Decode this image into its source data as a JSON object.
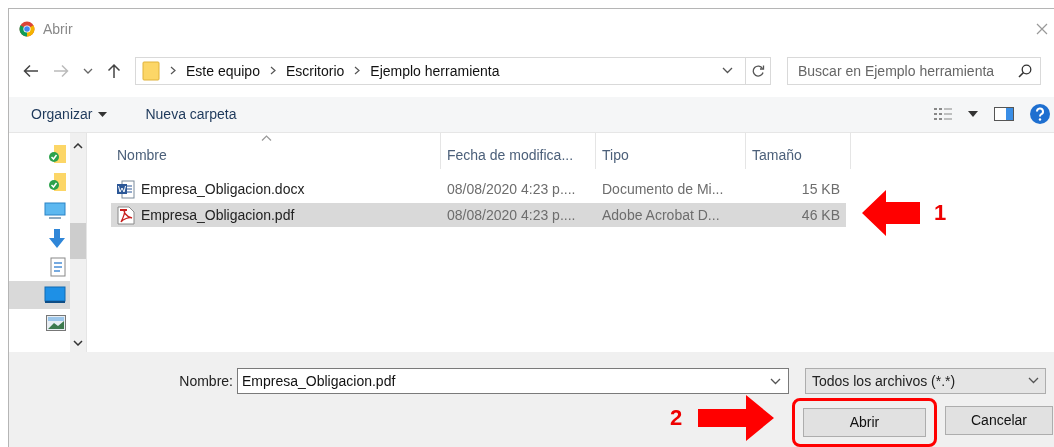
{
  "window": {
    "title": "Abrir"
  },
  "address_bar": {
    "path": [
      "Este equipo",
      "Escritorio",
      "Ejemplo herramienta"
    ]
  },
  "search": {
    "placeholder": "Buscar en Ejemplo herramienta"
  },
  "toolbar": {
    "buttons": [
      {
        "label": "Organizar",
        "kind": "menu"
      },
      {
        "label": "Nueva carpeta",
        "kind": "plain"
      }
    ]
  },
  "nav_pane": {
    "items": [
      {
        "kind": "synced-folder",
        "selected": false
      },
      {
        "kind": "synced-folder",
        "selected": false
      },
      {
        "kind": "computer",
        "selected": false
      },
      {
        "kind": "downloads",
        "selected": false
      },
      {
        "kind": "document",
        "selected": false
      },
      {
        "kind": "desktop",
        "selected": true
      },
      {
        "kind": "pictures",
        "selected": false
      }
    ]
  },
  "file_list": {
    "columns": [
      "Nombre",
      "Fecha de modifica...",
      "Tipo",
      "Tamaño"
    ],
    "rows": [
      {
        "kind": "word",
        "name": "Empresa_Obligacion.docx",
        "date": "08/08/2020 4:23 p....",
        "type": "Documento de Mi...",
        "size": "15 KB",
        "selected": false
      },
      {
        "kind": "pdf",
        "name": "Empresa_Obligacion.pdf",
        "date": "08/08/2020 4:23 p....",
        "type": "Adobe Acrobat D...",
        "size": "46 KB",
        "selected": true
      }
    ]
  },
  "file_name": {
    "label": "Nombre:",
    "value": "Empresa_Obligacion.pdf"
  },
  "file_type": {
    "value": "Todos los archivos (*.*)"
  },
  "buttons": [
    {
      "label": "Abrir",
      "highlighted": true
    },
    {
      "label": "Cancelar",
      "highlighted": false
    }
  ],
  "annotations": [
    {
      "label": "1",
      "kind": "left-arrow"
    },
    {
      "label": "2",
      "kind": "right-arrow"
    }
  ]
}
